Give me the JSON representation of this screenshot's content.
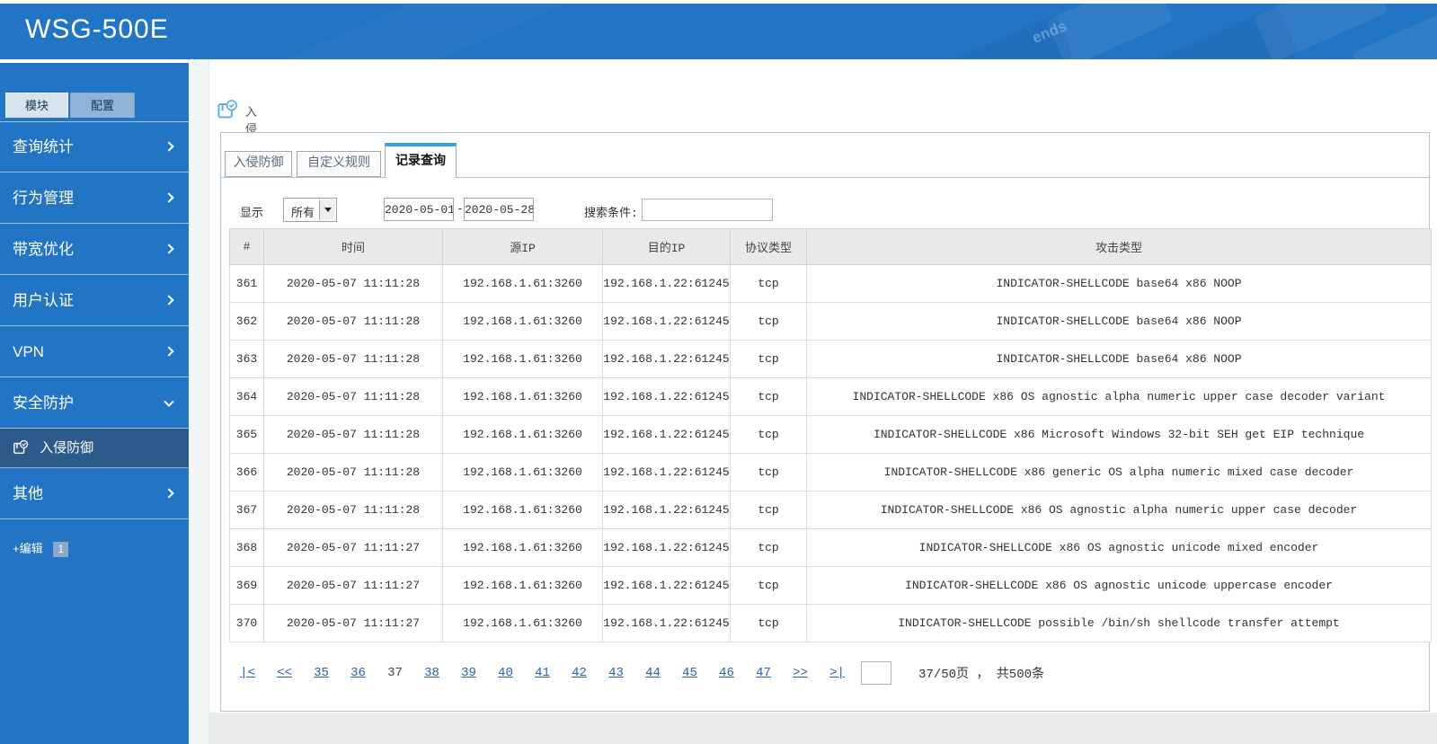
{
  "app": {
    "title": "WSG-500E"
  },
  "header": {
    "decor_text": "ends"
  },
  "sidebar": {
    "mode_tabs": [
      {
        "label": "模块"
      },
      {
        "label": "配置"
      }
    ],
    "items": [
      {
        "label": "查询统计"
      },
      {
        "label": "行为管理"
      },
      {
        "label": "带宽优化"
      },
      {
        "label": "用户认证"
      },
      {
        "label": "VPN"
      },
      {
        "label": "安全防护"
      }
    ],
    "active_subitem": {
      "label": "入侵防御"
    },
    "item_other": {
      "label": "其他"
    },
    "edit": {
      "label": "+编辑",
      "badge": "1"
    }
  },
  "breadcrumb": {
    "label": "入侵防御"
  },
  "tabs": [
    {
      "label": "入侵防御"
    },
    {
      "label": "自定义规则"
    },
    {
      "label": "记录查询"
    }
  ],
  "filters": {
    "display_label": "显示",
    "display_value": "所有",
    "date_from": "2020-05-01",
    "date_separator": "-",
    "date_to": "2020-05-28",
    "search_label": "搜索条件:",
    "search_value": ""
  },
  "table": {
    "headers": [
      "#",
      "时间",
      "源IP",
      "目的IP",
      "协议类型",
      "攻击类型"
    ],
    "rows": [
      [
        "361",
        "2020-05-07 11:11:28",
        "192.168.1.61:3260",
        "192.168.1.22:61245",
        "tcp",
        "INDICATOR-SHELLCODE base64 x86 NOOP"
      ],
      [
        "362",
        "2020-05-07 11:11:28",
        "192.168.1.61:3260",
        "192.168.1.22:61245",
        "tcp",
        "INDICATOR-SHELLCODE base64 x86 NOOP"
      ],
      [
        "363",
        "2020-05-07 11:11:28",
        "192.168.1.61:3260",
        "192.168.1.22:61245",
        "tcp",
        "INDICATOR-SHELLCODE base64 x86 NOOP"
      ],
      [
        "364",
        "2020-05-07 11:11:28",
        "192.168.1.61:3260",
        "192.168.1.22:61245",
        "tcp",
        "INDICATOR-SHELLCODE x86 OS agnostic alpha numeric upper case decoder variant"
      ],
      [
        "365",
        "2020-05-07 11:11:28",
        "192.168.1.61:3260",
        "192.168.1.22:61245",
        "tcp",
        "INDICATOR-SHELLCODE x86 Microsoft Windows 32-bit SEH get EIP technique"
      ],
      [
        "366",
        "2020-05-07 11:11:28",
        "192.168.1.61:3260",
        "192.168.1.22:61245",
        "tcp",
        "INDICATOR-SHELLCODE x86 generic OS alpha numeric mixed case decoder"
      ],
      [
        "367",
        "2020-05-07 11:11:28",
        "192.168.1.61:3260",
        "192.168.1.22:61245",
        "tcp",
        "INDICATOR-SHELLCODE x86 OS agnostic alpha numeric upper case decoder"
      ],
      [
        "368",
        "2020-05-07 11:11:27",
        "192.168.1.61:3260",
        "192.168.1.22:61245",
        "tcp",
        "INDICATOR-SHELLCODE x86 OS agnostic unicode mixed encoder"
      ],
      [
        "369",
        "2020-05-07 11:11:27",
        "192.168.1.61:3260",
        "192.168.1.22:61245",
        "tcp",
        "INDICATOR-SHELLCODE x86 OS agnostic unicode uppercase encoder"
      ],
      [
        "370",
        "2020-05-07 11:11:27",
        "192.168.1.61:3260",
        "192.168.1.22:61245",
        "tcp",
        "INDICATOR-SHELLCODE possible /bin/sh shellcode transfer attempt"
      ]
    ]
  },
  "pagination": {
    "first": "|<",
    "prev": "<<",
    "pages": [
      "35",
      "36",
      "37",
      "38",
      "39",
      "40",
      "41",
      "42",
      "43",
      "44",
      "45",
      "46",
      "47"
    ],
    "current": "37",
    "next": ">>",
    "last": ">|",
    "jump_value": "",
    "info": "37/50页 ， 共500条"
  },
  "colors": {
    "header_blue": "#2274c4",
    "active_submenu": "#2b5a8b",
    "tab_accent": "#3c9fe6",
    "link_blue": "#2a64a8"
  }
}
